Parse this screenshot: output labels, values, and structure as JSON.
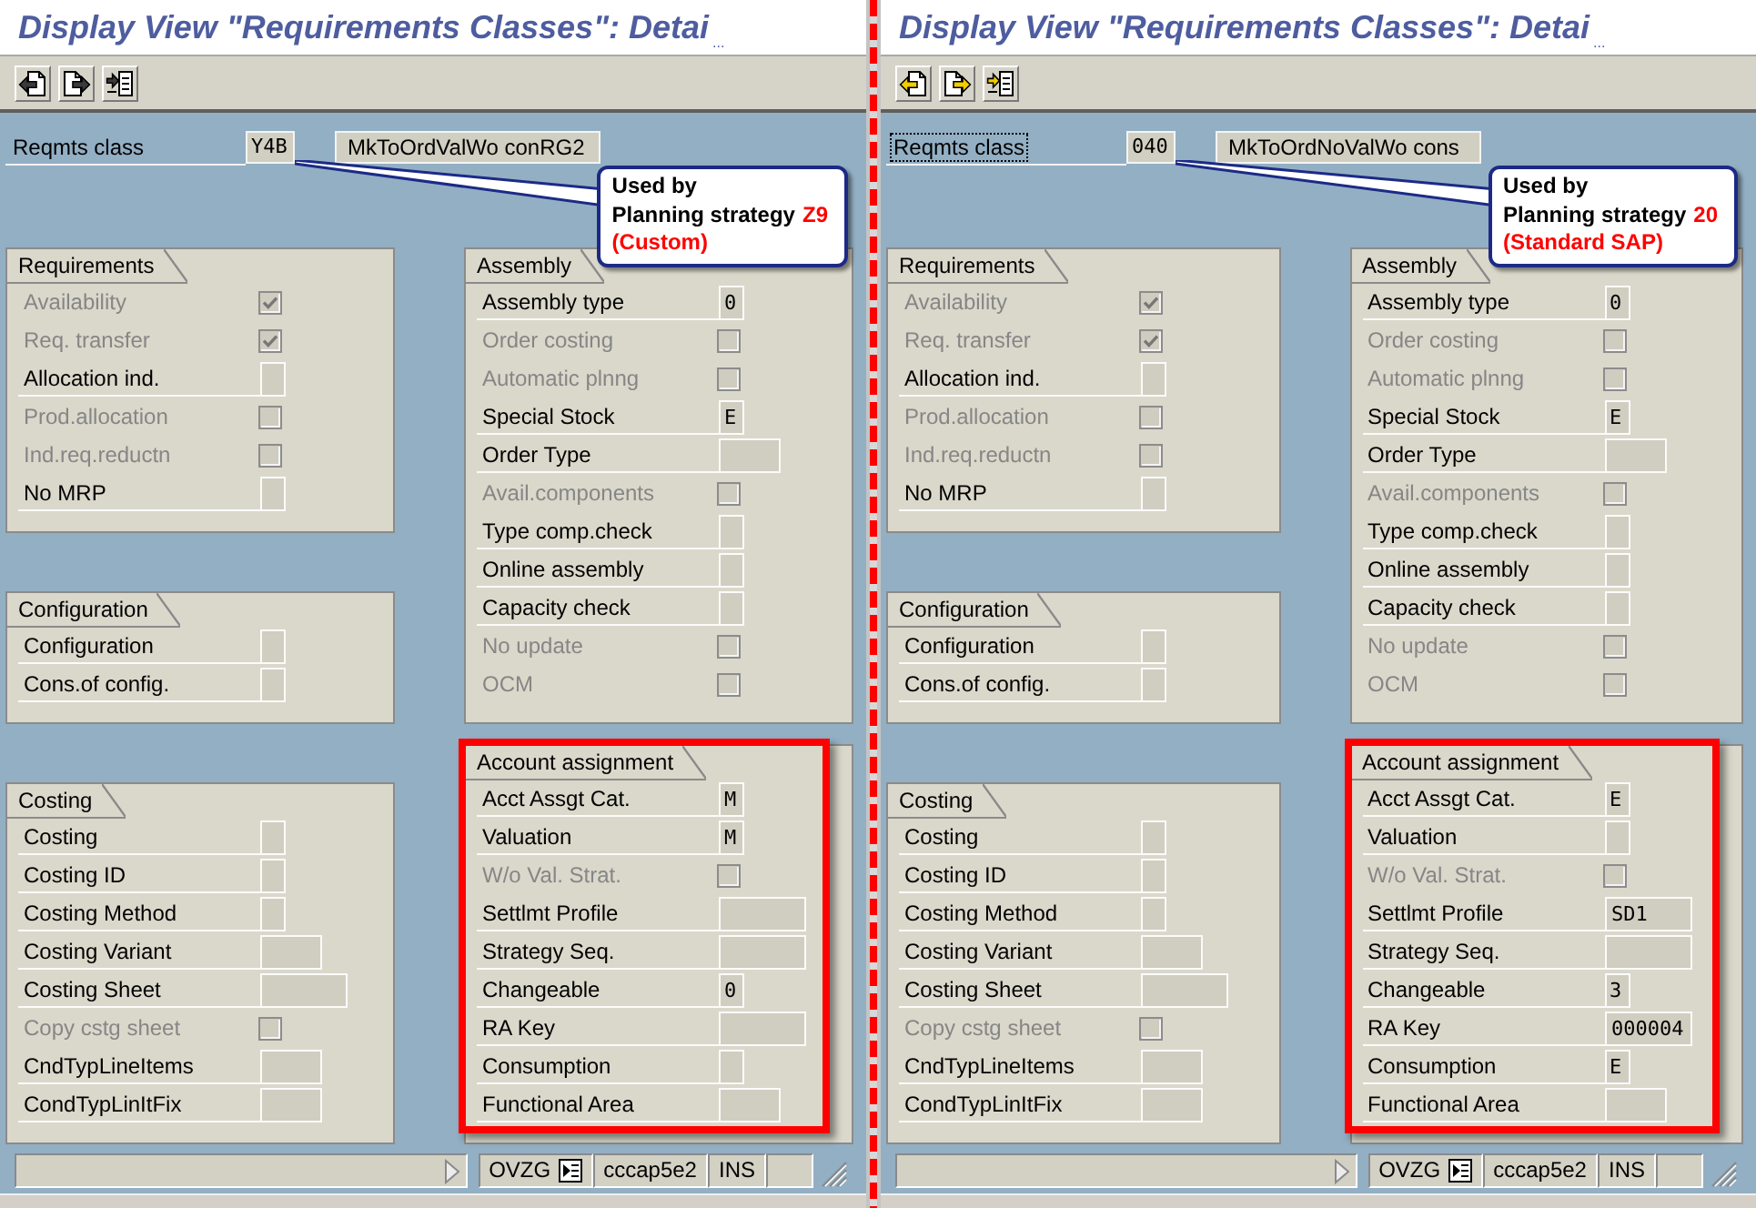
{
  "screens": [
    {
      "title": "Display View \"Requirements Classes\": Detai",
      "title_overflow": "...",
      "toolbar": [
        {
          "disabled": true
        },
        {
          "disabled": true
        },
        {
          "disabled": true
        }
      ],
      "header": {
        "label": "Reqmts class",
        "focused": false,
        "value": "Y4B",
        "description": "MkToOrdValWo conRG2"
      },
      "callout": {
        "heading": "Used by",
        "label": "Planning strategy",
        "strategy": "Z9",
        "origin": "(Custom)"
      },
      "columns": [
        {
          "groups": [
            {
              "title": "Requirements",
              "highlighted": false,
              "rows": [
                {
                  "label": "Availability",
                  "kind": "checkbox",
                  "disabled": true,
                  "checked": true
                },
                {
                  "label": "Req. transfer",
                  "kind": "checkbox",
                  "disabled": true,
                  "checked": true
                },
                {
                  "label": "Allocation ind.",
                  "kind": "flag",
                  "disabled": false
                },
                {
                  "label": "Prod.allocation",
                  "kind": "checkbox",
                  "disabled": true,
                  "checked": false
                },
                {
                  "label": "Ind.req.reductn",
                  "kind": "checkbox",
                  "disabled": true,
                  "checked": false
                },
                {
                  "label": "No MRP",
                  "kind": "flag",
                  "disabled": false
                }
              ]
            },
            {
              "title": "Configuration",
              "highlighted": false,
              "rows": [
                {
                  "label": "Configuration",
                  "kind": "flag",
                  "disabled": false
                },
                {
                  "label": "Cons.of config.",
                  "kind": "flag",
                  "disabled": false
                }
              ]
            },
            {
              "title": "Costing",
              "highlighted": false,
              "rows": [
                {
                  "label": "Costing",
                  "kind": "flag",
                  "disabled": false
                },
                {
                  "label": "Costing ID",
                  "kind": "flag",
                  "disabled": false
                },
                {
                  "label": "Costing Method",
                  "kind": "flag",
                  "disabled": false
                },
                {
                  "label": "Costing Variant",
                  "kind": "code",
                  "disabled": false
                },
                {
                  "label": "Costing Sheet",
                  "kind": "key",
                  "disabled": false
                },
                {
                  "label": "Copy cstg sheet",
                  "kind": "checkbox",
                  "disabled": true,
                  "checked": false
                },
                {
                  "label": "CndTypLineItems",
                  "kind": "code",
                  "disabled": false
                },
                {
                  "label": "CondTypLinItFix",
                  "kind": "code",
                  "disabled": false
                }
              ]
            }
          ]
        },
        {
          "groups": [
            {
              "title": "Assembly",
              "highlighted": false,
              "rows": [
                {
                  "label": "Assembly type",
                  "kind": "flag",
                  "disabled": false,
                  "value": "0"
                },
                {
                  "label": "Order costing",
                  "kind": "checkbox",
                  "disabled": true,
                  "checked": false
                },
                {
                  "label": "Automatic plnng",
                  "kind": "checkbox",
                  "disabled": true,
                  "checked": false
                },
                {
                  "label": "Special Stock",
                  "kind": "flag",
                  "disabled": false,
                  "value": "E"
                },
                {
                  "label": "Order Type",
                  "kind": "code",
                  "disabled": false
                },
                {
                  "label": "Avail.components",
                  "kind": "checkbox",
                  "disabled": true,
                  "checked": false
                },
                {
                  "label": "Type comp.check",
                  "kind": "flag",
                  "disabled": false
                },
                {
                  "label": "Online assembly",
                  "kind": "flag",
                  "disabled": false
                },
                {
                  "label": "Capacity check",
                  "kind": "flag",
                  "disabled": false
                },
                {
                  "label": "No update",
                  "kind": "checkbox",
                  "disabled": true,
                  "checked": false
                },
                {
                  "label": "OCM",
                  "kind": "checkbox",
                  "disabled": true,
                  "checked": false
                }
              ]
            },
            {
              "title": "Account assignment",
              "highlighted": true,
              "rows": [
                {
                  "label": "Acct Assgt Cat.",
                  "kind": "flag",
                  "disabled": false,
                  "value": "M"
                },
                {
                  "label": "Valuation",
                  "kind": "flag",
                  "disabled": false,
                  "value": "M"
                },
                {
                  "label": "W/o Val. Strat.",
                  "kind": "checkbox",
                  "disabled": true,
                  "checked": false
                },
                {
                  "label": "Settlmt Profile",
                  "kind": "key",
                  "disabled": false
                },
                {
                  "label": "Strategy Seq.",
                  "kind": "key",
                  "disabled": false
                },
                {
                  "label": "Changeable",
                  "kind": "flag",
                  "disabled": false,
                  "value": "0"
                },
                {
                  "label": "RA Key",
                  "kind": "key",
                  "disabled": false
                },
                {
                  "label": "Consumption",
                  "kind": "flag",
                  "disabled": false
                },
                {
                  "label": "Functional Area",
                  "kind": "code",
                  "disabled": false
                }
              ]
            }
          ]
        }
      ],
      "status_bar": {
        "system": "OVZG",
        "server": "cccap5e2",
        "mode": "INS"
      }
    },
    {
      "title": "Display View \"Requirements Classes\": Detai",
      "title_overflow": "...",
      "toolbar": [
        {
          "disabled": false
        },
        {
          "disabled": false
        },
        {
          "disabled": false
        }
      ],
      "header": {
        "label": "Reqmts class",
        "focused": true,
        "value": "040",
        "description": "MkToOrdNoValWo cons"
      },
      "callout": {
        "heading": "Used by",
        "label": "Planning strategy",
        "strategy": "20",
        "origin": "(Standard SAP)"
      },
      "columns": [
        {
          "groups": [
            {
              "title": "Requirements",
              "highlighted": false,
              "rows": [
                {
                  "label": "Availability",
                  "kind": "checkbox",
                  "disabled": true,
                  "checked": true
                },
                {
                  "label": "Req. transfer",
                  "kind": "checkbox",
                  "disabled": true,
                  "checked": true
                },
                {
                  "label": "Allocation ind.",
                  "kind": "flag",
                  "disabled": false
                },
                {
                  "label": "Prod.allocation",
                  "kind": "checkbox",
                  "disabled": true,
                  "checked": false
                },
                {
                  "label": "Ind.req.reductn",
                  "kind": "checkbox",
                  "disabled": true,
                  "checked": false
                },
                {
                  "label": "No MRP",
                  "kind": "flag",
                  "disabled": false
                }
              ]
            },
            {
              "title": "Configuration",
              "highlighted": false,
              "rows": [
                {
                  "label": "Configuration",
                  "kind": "flag",
                  "disabled": false
                },
                {
                  "label": "Cons.of config.",
                  "kind": "flag",
                  "disabled": false
                }
              ]
            },
            {
              "title": "Costing",
              "highlighted": false,
              "rows": [
                {
                  "label": "Costing",
                  "kind": "flag",
                  "disabled": false
                },
                {
                  "label": "Costing ID",
                  "kind": "flag",
                  "disabled": false
                },
                {
                  "label": "Costing Method",
                  "kind": "flag",
                  "disabled": false
                },
                {
                  "label": "Costing Variant",
                  "kind": "code",
                  "disabled": false
                },
                {
                  "label": "Costing Sheet",
                  "kind": "key",
                  "disabled": false
                },
                {
                  "label": "Copy cstg sheet",
                  "kind": "checkbox",
                  "disabled": true,
                  "checked": false
                },
                {
                  "label": "CndTypLineItems",
                  "kind": "code",
                  "disabled": false
                },
                {
                  "label": "CondTypLinItFix",
                  "kind": "code",
                  "disabled": false
                }
              ]
            }
          ]
        },
        {
          "groups": [
            {
              "title": "Assembly",
              "highlighted": false,
              "rows": [
                {
                  "label": "Assembly type",
                  "kind": "flag",
                  "disabled": false,
                  "value": "0"
                },
                {
                  "label": "Order costing",
                  "kind": "checkbox",
                  "disabled": true,
                  "checked": false
                },
                {
                  "label": "Automatic plnng",
                  "kind": "checkbox",
                  "disabled": true,
                  "checked": false
                },
                {
                  "label": "Special Stock",
                  "kind": "flag",
                  "disabled": false,
                  "value": "E"
                },
                {
                  "label": "Order Type",
                  "kind": "code",
                  "disabled": false
                },
                {
                  "label": "Avail.components",
                  "kind": "checkbox",
                  "disabled": true,
                  "checked": false
                },
                {
                  "label": "Type comp.check",
                  "kind": "flag",
                  "disabled": false
                },
                {
                  "label": "Online assembly",
                  "kind": "flag",
                  "disabled": false
                },
                {
                  "label": "Capacity check",
                  "kind": "flag",
                  "disabled": false
                },
                {
                  "label": "No update",
                  "kind": "checkbox",
                  "disabled": true,
                  "checked": false
                },
                {
                  "label": "OCM",
                  "kind": "checkbox",
                  "disabled": true,
                  "checked": false
                }
              ]
            },
            {
              "title": "Account assignment",
              "highlighted": true,
              "rows": [
                {
                  "label": "Acct Assgt Cat.",
                  "kind": "flag",
                  "disabled": false,
                  "value": "E"
                },
                {
                  "label": "Valuation",
                  "kind": "flag",
                  "disabled": false
                },
                {
                  "label": "W/o Val. Strat.",
                  "kind": "checkbox",
                  "disabled": true,
                  "checked": false
                },
                {
                  "label": "Settlmt Profile",
                  "kind": "key",
                  "disabled": false,
                  "value": "SD1"
                },
                {
                  "label": "Strategy Seq.",
                  "kind": "key",
                  "disabled": false
                },
                {
                  "label": "Changeable",
                  "kind": "flag",
                  "disabled": false,
                  "value": "3"
                },
                {
                  "label": "RA Key",
                  "kind": "key",
                  "disabled": false,
                  "value": "000004"
                },
                {
                  "label": "Consumption",
                  "kind": "flag",
                  "disabled": false,
                  "value": "E"
                },
                {
                  "label": "Functional Area",
                  "kind": "code",
                  "disabled": false
                }
              ]
            }
          ]
        }
      ],
      "status_bar": {
        "system": "OVZG",
        "server": "cccap5e2",
        "mode": "INS"
      }
    }
  ]
}
